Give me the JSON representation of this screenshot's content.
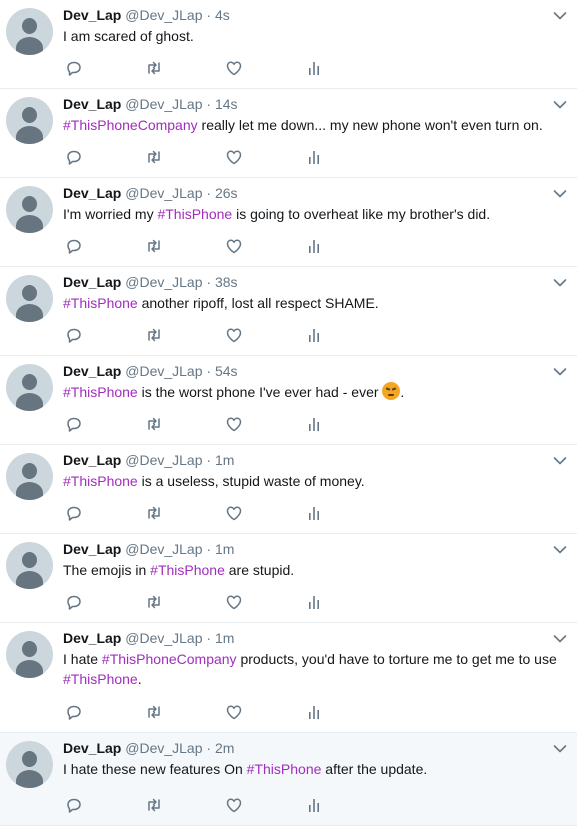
{
  "tweets": [
    {
      "name": "Dev_Lap",
      "handle": "@Dev_JLap",
      "dot": "·",
      "time": "4s",
      "parts": [
        {
          "t": "I am scared of ghost."
        }
      ]
    },
    {
      "name": "Dev_Lap",
      "handle": "@Dev_JLap",
      "dot": "·",
      "time": "14s",
      "parts": [
        {
          "t": "#ThisPhoneCompany",
          "tag": true
        },
        {
          "t": " really let me down... my new phone won't even turn on."
        }
      ]
    },
    {
      "name": "Dev_Lap",
      "handle": "@Dev_JLap",
      "dot": "·",
      "time": "26s",
      "parts": [
        {
          "t": "I'm worried my "
        },
        {
          "t": "#ThisPhone",
          "tag": true
        },
        {
          "t": " is going to overheat like my brother's did."
        }
      ]
    },
    {
      "name": "Dev_Lap",
      "handle": "@Dev_JLap",
      "dot": "·",
      "time": "38s",
      "parts": [
        {
          "t": "#ThisPhone",
          "tag": true
        },
        {
          "t": " another ripoff, lost all respect SHAME."
        }
      ]
    },
    {
      "name": "Dev_Lap",
      "handle": "@Dev_JLap",
      "dot": "·",
      "time": "54s",
      "parts": [
        {
          "t": "#ThisPhone",
          "tag": true
        },
        {
          "t": " is the worst phone I've ever had - ever "
        },
        {
          "emoji": "angry-face"
        },
        {
          "t": "."
        }
      ]
    },
    {
      "name": "Dev_Lap",
      "handle": "@Dev_JLap",
      "dot": "·",
      "time": "1m",
      "parts": [
        {
          "t": "#ThisPhone",
          "tag": true
        },
        {
          "t": " is a useless, stupid waste of money."
        }
      ]
    },
    {
      "name": "Dev_Lap",
      "handle": "@Dev_JLap",
      "dot": "·",
      "time": "1m",
      "parts": [
        {
          "t": "The emojis in "
        },
        {
          "t": "#ThisPhone",
          "tag": true
        },
        {
          "t": " are stupid."
        }
      ]
    },
    {
      "name": "Dev_Lap",
      "handle": "@Dev_JLap",
      "dot": "·",
      "time": "1m",
      "parts": [
        {
          "t": "I hate "
        },
        {
          "t": "#ThisPhoneCompany",
          "tag": true
        },
        {
          "t": " products, you'd have to torture me to get me to use "
        },
        {
          "t": "#ThisPhone",
          "tag": true
        },
        {
          "t": "."
        }
      ]
    },
    {
      "name": "Dev_Lap",
      "handle": "@Dev_JLap",
      "dot": "·",
      "time": "2m",
      "parts": [
        {
          "t": "I hate these new features On "
        },
        {
          "t": "#ThisPhone",
          "tag": true
        },
        {
          "t": " after the update."
        }
      ]
    }
  ],
  "icons": {
    "reply": "reply-icon",
    "retweet": "retweet-icon",
    "like": "heart-icon",
    "analytics": "analytics-icon",
    "more": "chevron-down-icon"
  },
  "colors": {
    "hashtag": "#a12dbd",
    "meta": "#657786",
    "icon": "#657786",
    "divider": "#e6ecf0",
    "avatar_bg": "#ccd6dd"
  }
}
